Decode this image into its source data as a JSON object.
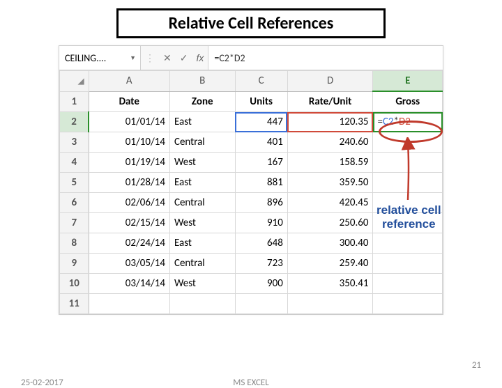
{
  "slide": {
    "title": "Relative Cell References"
  },
  "formula_bar": {
    "name_box": "CEILING....",
    "cancel": "✕",
    "confirm": "✓",
    "fx": "fx",
    "formula": "=C2*D2"
  },
  "headers": [
    "A",
    "B",
    "C",
    "D",
    "E"
  ],
  "row_header": [
    "Date",
    "Zone",
    "Units",
    "Rate/Unit",
    "Gross"
  ],
  "rows": [
    {
      "n": "1"
    },
    {
      "n": "2",
      "date": "01/01/14",
      "zone": "East",
      "units": "447",
      "rate": "120.35"
    },
    {
      "n": "3",
      "date": "01/10/14",
      "zone": "Central",
      "units": "401",
      "rate": "240.60"
    },
    {
      "n": "4",
      "date": "01/19/14",
      "zone": "West",
      "units": "167",
      "rate": "158.59"
    },
    {
      "n": "5",
      "date": "01/28/14",
      "zone": "East",
      "units": "881",
      "rate": "359.50"
    },
    {
      "n": "6",
      "date": "02/06/14",
      "zone": "Central",
      "units": "896",
      "rate": "420.45"
    },
    {
      "n": "7",
      "date": "02/15/14",
      "zone": "West",
      "units": "910",
      "rate": "250.60"
    },
    {
      "n": "8",
      "date": "02/24/14",
      "zone": "East",
      "units": "648",
      "rate": "300.40"
    },
    {
      "n": "9",
      "date": "03/05/14",
      "zone": "Central",
      "units": "723",
      "rate": "259.40"
    },
    {
      "n": "10",
      "date": "03/14/14",
      "zone": "West",
      "units": "900",
      "rate": "350.41"
    },
    {
      "n": "11"
    }
  ],
  "active_cell_formula": {
    "eq": "=",
    "c": "C2",
    "star": "*",
    "d": "D2"
  },
  "annotation": {
    "line1": "relative cell",
    "line2": "reference"
  },
  "footer": {
    "date": "25-02-2017",
    "center": "MS EXCEL",
    "page": "21"
  }
}
